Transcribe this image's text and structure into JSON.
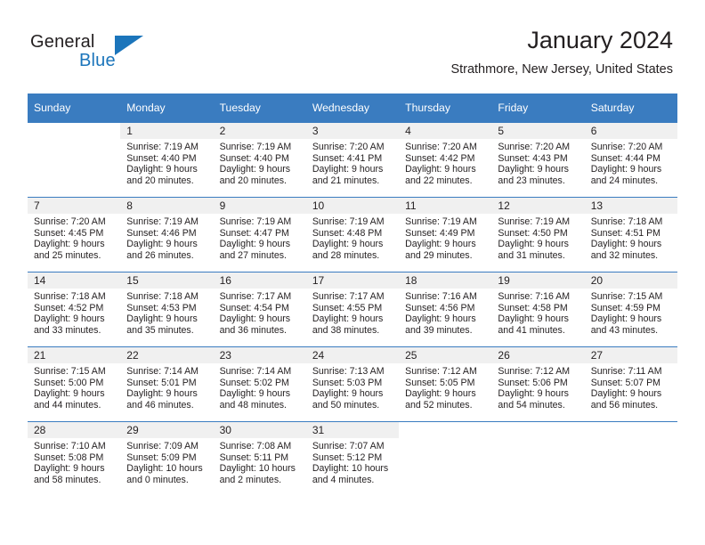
{
  "brand": {
    "word_general": "General",
    "word_blue": "Blue"
  },
  "header": {
    "title": "January 2024",
    "location": "Strathmore, New Jersey, United States"
  },
  "calendar": {
    "weekday_headers": [
      "Sunday",
      "Monday",
      "Tuesday",
      "Wednesday",
      "Thursday",
      "Friday",
      "Saturday"
    ],
    "accent_color": "#3a7cc0",
    "daynum_background": "#f0f0f0",
    "weeks": [
      [
        {
          "day": "",
          "lines": []
        },
        {
          "day": "1",
          "lines": [
            "Sunrise: 7:19 AM",
            "Sunset: 4:40 PM",
            "Daylight: 9 hours",
            "and 20 minutes."
          ]
        },
        {
          "day": "2",
          "lines": [
            "Sunrise: 7:19 AM",
            "Sunset: 4:40 PM",
            "Daylight: 9 hours",
            "and 20 minutes."
          ]
        },
        {
          "day": "3",
          "lines": [
            "Sunrise: 7:20 AM",
            "Sunset: 4:41 PM",
            "Daylight: 9 hours",
            "and 21 minutes."
          ]
        },
        {
          "day": "4",
          "lines": [
            "Sunrise: 7:20 AM",
            "Sunset: 4:42 PM",
            "Daylight: 9 hours",
            "and 22 minutes."
          ]
        },
        {
          "day": "5",
          "lines": [
            "Sunrise: 7:20 AM",
            "Sunset: 4:43 PM",
            "Daylight: 9 hours",
            "and 23 minutes."
          ]
        },
        {
          "day": "6",
          "lines": [
            "Sunrise: 7:20 AM",
            "Sunset: 4:44 PM",
            "Daylight: 9 hours",
            "and 24 minutes."
          ]
        }
      ],
      [
        {
          "day": "7",
          "lines": [
            "Sunrise: 7:20 AM",
            "Sunset: 4:45 PM",
            "Daylight: 9 hours",
            "and 25 minutes."
          ]
        },
        {
          "day": "8",
          "lines": [
            "Sunrise: 7:19 AM",
            "Sunset: 4:46 PM",
            "Daylight: 9 hours",
            "and 26 minutes."
          ]
        },
        {
          "day": "9",
          "lines": [
            "Sunrise: 7:19 AM",
            "Sunset: 4:47 PM",
            "Daylight: 9 hours",
            "and 27 minutes."
          ]
        },
        {
          "day": "10",
          "lines": [
            "Sunrise: 7:19 AM",
            "Sunset: 4:48 PM",
            "Daylight: 9 hours",
            "and 28 minutes."
          ]
        },
        {
          "day": "11",
          "lines": [
            "Sunrise: 7:19 AM",
            "Sunset: 4:49 PM",
            "Daylight: 9 hours",
            "and 29 minutes."
          ]
        },
        {
          "day": "12",
          "lines": [
            "Sunrise: 7:19 AM",
            "Sunset: 4:50 PM",
            "Daylight: 9 hours",
            "and 31 minutes."
          ]
        },
        {
          "day": "13",
          "lines": [
            "Sunrise: 7:18 AM",
            "Sunset: 4:51 PM",
            "Daylight: 9 hours",
            "and 32 minutes."
          ]
        }
      ],
      [
        {
          "day": "14",
          "lines": [
            "Sunrise: 7:18 AM",
            "Sunset: 4:52 PM",
            "Daylight: 9 hours",
            "and 33 minutes."
          ]
        },
        {
          "day": "15",
          "lines": [
            "Sunrise: 7:18 AM",
            "Sunset: 4:53 PM",
            "Daylight: 9 hours",
            "and 35 minutes."
          ]
        },
        {
          "day": "16",
          "lines": [
            "Sunrise: 7:17 AM",
            "Sunset: 4:54 PM",
            "Daylight: 9 hours",
            "and 36 minutes."
          ]
        },
        {
          "day": "17",
          "lines": [
            "Sunrise: 7:17 AM",
            "Sunset: 4:55 PM",
            "Daylight: 9 hours",
            "and 38 minutes."
          ]
        },
        {
          "day": "18",
          "lines": [
            "Sunrise: 7:16 AM",
            "Sunset: 4:56 PM",
            "Daylight: 9 hours",
            "and 39 minutes."
          ]
        },
        {
          "day": "19",
          "lines": [
            "Sunrise: 7:16 AM",
            "Sunset: 4:58 PM",
            "Daylight: 9 hours",
            "and 41 minutes."
          ]
        },
        {
          "day": "20",
          "lines": [
            "Sunrise: 7:15 AM",
            "Sunset: 4:59 PM",
            "Daylight: 9 hours",
            "and 43 minutes."
          ]
        }
      ],
      [
        {
          "day": "21",
          "lines": [
            "Sunrise: 7:15 AM",
            "Sunset: 5:00 PM",
            "Daylight: 9 hours",
            "and 44 minutes."
          ]
        },
        {
          "day": "22",
          "lines": [
            "Sunrise: 7:14 AM",
            "Sunset: 5:01 PM",
            "Daylight: 9 hours",
            "and 46 minutes."
          ]
        },
        {
          "day": "23",
          "lines": [
            "Sunrise: 7:14 AM",
            "Sunset: 5:02 PM",
            "Daylight: 9 hours",
            "and 48 minutes."
          ]
        },
        {
          "day": "24",
          "lines": [
            "Sunrise: 7:13 AM",
            "Sunset: 5:03 PM",
            "Daylight: 9 hours",
            "and 50 minutes."
          ]
        },
        {
          "day": "25",
          "lines": [
            "Sunrise: 7:12 AM",
            "Sunset: 5:05 PM",
            "Daylight: 9 hours",
            "and 52 minutes."
          ]
        },
        {
          "day": "26",
          "lines": [
            "Sunrise: 7:12 AM",
            "Sunset: 5:06 PM",
            "Daylight: 9 hours",
            "and 54 minutes."
          ]
        },
        {
          "day": "27",
          "lines": [
            "Sunrise: 7:11 AM",
            "Sunset: 5:07 PM",
            "Daylight: 9 hours",
            "and 56 minutes."
          ]
        }
      ],
      [
        {
          "day": "28",
          "lines": [
            "Sunrise: 7:10 AM",
            "Sunset: 5:08 PM",
            "Daylight: 9 hours",
            "and 58 minutes."
          ]
        },
        {
          "day": "29",
          "lines": [
            "Sunrise: 7:09 AM",
            "Sunset: 5:09 PM",
            "Daylight: 10 hours",
            "and 0 minutes."
          ]
        },
        {
          "day": "30",
          "lines": [
            "Sunrise: 7:08 AM",
            "Sunset: 5:11 PM",
            "Daylight: 10 hours",
            "and 2 minutes."
          ]
        },
        {
          "day": "31",
          "lines": [
            "Sunrise: 7:07 AM",
            "Sunset: 5:12 PM",
            "Daylight: 10 hours",
            "and 4 minutes."
          ]
        },
        {
          "day": "",
          "lines": []
        },
        {
          "day": "",
          "lines": []
        },
        {
          "day": "",
          "lines": []
        }
      ]
    ]
  }
}
